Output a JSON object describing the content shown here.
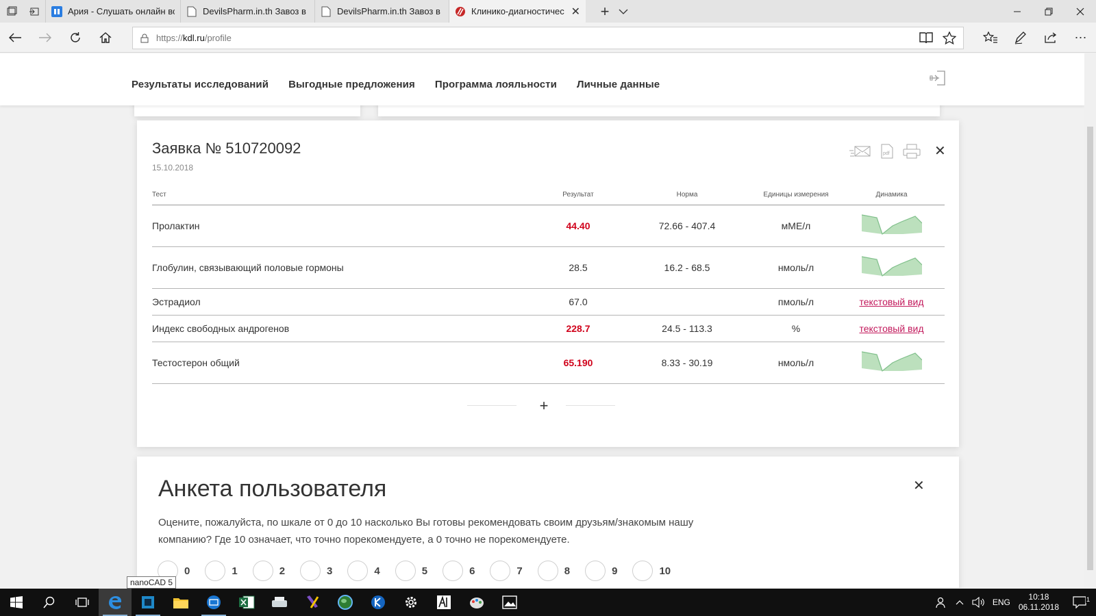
{
  "browser": {
    "tabs": [
      {
        "title": "Ария - Слушать онлайн все",
        "active": false,
        "favicon": "music-service-icon"
      },
      {
        "title": "DevilsPharm.in.th Завоз в п",
        "active": false,
        "favicon": "page-icon"
      },
      {
        "title": "DevilsPharm.in.th Завоз в п",
        "active": false,
        "favicon": "page-icon"
      },
      {
        "title": "Клинико-диагностичес",
        "active": true,
        "favicon": "kdl-logo-icon"
      }
    ],
    "url": {
      "scheme": "https://",
      "host": "kdl.ru",
      "path": "/profile"
    }
  },
  "site": {
    "nav": [
      "Результаты исследований",
      "Выгодные предложения",
      "Программа лояльности",
      "Личные данные"
    ]
  },
  "order": {
    "title": "Заявка № 510720092",
    "date": "15.10.2018",
    "columns": {
      "test": "Тест",
      "result": "Результат",
      "norm": "Норма",
      "units": "Единицы измерения",
      "dynamics": "Динамика"
    },
    "rows": [
      {
        "test": "Пролактин",
        "result": "44.40",
        "abnormal": true,
        "norm": "72.66 - 407.4",
        "units": "мМЕ/л",
        "dynamics": "chart",
        "dynamics_text": ""
      },
      {
        "test": "Глобулин, связывающий половые гормоны",
        "result": "28.5",
        "abnormal": false,
        "norm": "16.2 - 68.5",
        "units": "нмоль/л",
        "dynamics": "chart",
        "dynamics_text": ""
      },
      {
        "test": "Эстрадиол",
        "result": "67.0",
        "abnormal": false,
        "norm": "",
        "units": "пмоль/л",
        "dynamics": "link",
        "dynamics_text": "текстовый вид"
      },
      {
        "test": "Индекс свободных андрогенов",
        "result": "228.7",
        "abnormal": true,
        "norm": "24.5 - 113.3",
        "units": "%",
        "dynamics": "link",
        "dynamics_text": "текстовый вид"
      },
      {
        "test": "Тестостерон общий",
        "result": "65.190",
        "abnormal": true,
        "norm": "8.33 - 30.19",
        "units": "нмоль/л",
        "dynamics": "chart",
        "dynamics_text": ""
      }
    ],
    "more_label": "+",
    "colors": {
      "abnormal": "#d0021b",
      "link": "#c2185b",
      "sparkline": "#a5d6a7"
    }
  },
  "survey": {
    "title": "Анкета пользователя",
    "question": "Оцените, пожалуйста, по шкале от 0 до 10 насколько Вы готовы рекомендовать своим друзьям/знакомым нашу компанию? Где 10 означает, что точно порекомендуете, а 0 точно не порекомендуете.",
    "options": [
      "0",
      "1",
      "2",
      "3",
      "4",
      "5",
      "6",
      "7",
      "8",
      "9",
      "10"
    ]
  },
  "tooltip": "nanoCAD 5",
  "taskbar": {
    "apps": [
      "start-icon",
      "search-icon",
      "task-view-icon",
      "edge-icon",
      "nanocad-icon",
      "file-explorer-icon",
      "remote-desktop-icon",
      "excel-icon",
      "scanner-icon",
      "visual-studio-icon",
      "globe-icon",
      "kompas-icon",
      "settings-icon",
      "app-icon",
      "paint-icon",
      "photos-icon"
    ],
    "lang": "ENG",
    "time": "10:18",
    "date": "06.11.2018",
    "notifications": "1"
  }
}
